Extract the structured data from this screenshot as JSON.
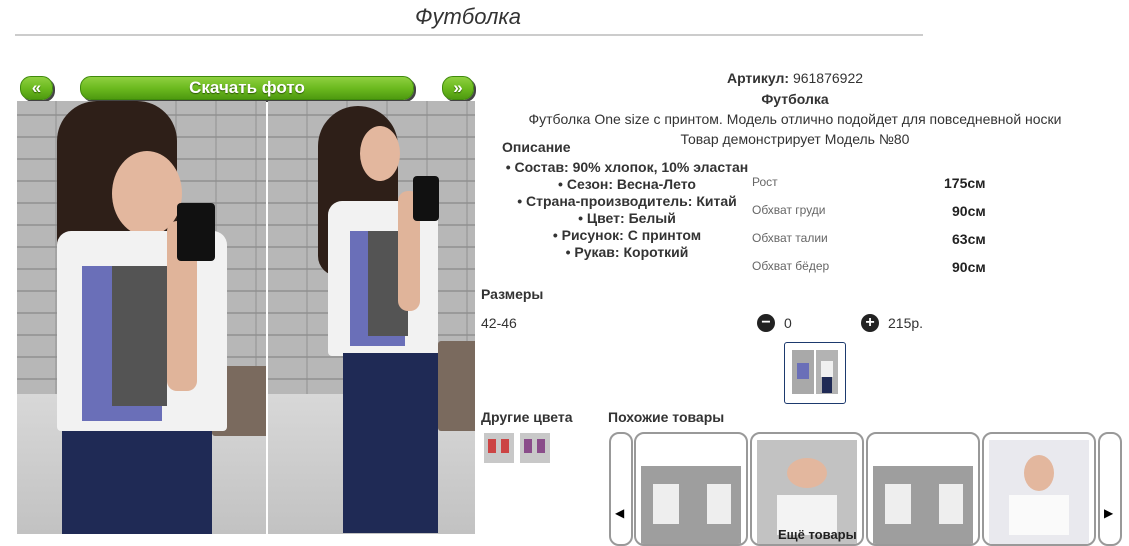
{
  "page": {
    "title": "Футболка"
  },
  "gallery": {
    "prev_label": "«",
    "download_label": "Скачать фото",
    "next_label": "»"
  },
  "product": {
    "sku_label": "Артикул:",
    "sku_value": "961876922",
    "name": "Футболка",
    "description": "Футболка One size с принтом. Модель отлично подойдет для повседневной носки",
    "model_note": "Товар демонстрирует Модель №80"
  },
  "description_section": {
    "title": "Описание",
    "items": [
      "Состав: 90% хлопок, 10% эластан",
      "Сезон: Весна-Лето",
      "Страна-производитель: Китай",
      "Цвет: Белый",
      "Рисунок: С принтом",
      "Рукав: Короткий"
    ]
  },
  "measurements": [
    {
      "label": "Рост",
      "value": "175см"
    },
    {
      "label": "Обхват груди",
      "value": "90см"
    },
    {
      "label": "Обхват талии",
      "value": "63см"
    },
    {
      "label": "Обхват бёдер",
      "value": "90см"
    }
  ],
  "sizes": {
    "title": "Размеры",
    "size": "42-46",
    "quantity": "0",
    "price": "215р."
  },
  "other_colors": {
    "title": "Другие цвета"
  },
  "similar": {
    "title": "Похожие товары",
    "more_label": "Ещё товары"
  },
  "icons": {
    "minus": "minus-circle-icon",
    "plus": "plus-circle-icon",
    "left": "arrow-left-icon",
    "right": "arrow-right-icon"
  },
  "colors": {
    "accent_green": "#6cba1f",
    "border_blue": "#1d3a6e",
    "print_blue": "#6a6fb8",
    "jeans": "#1f2a55"
  }
}
